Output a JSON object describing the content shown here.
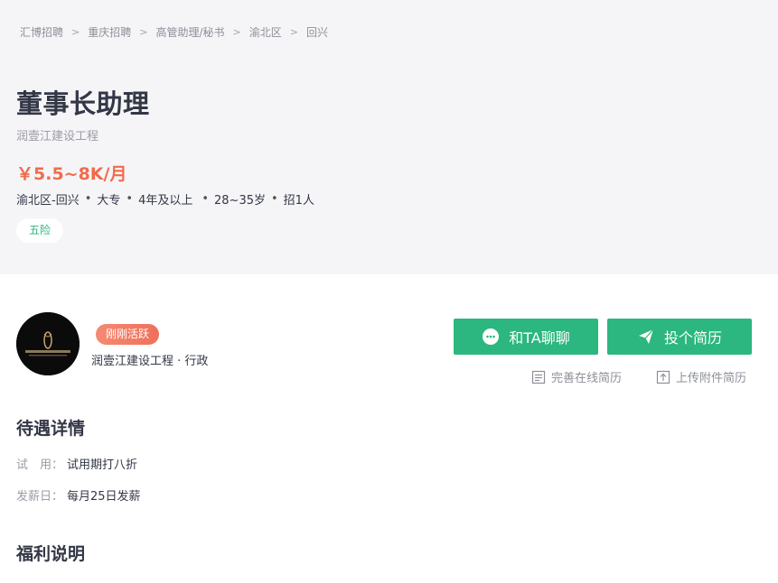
{
  "breadcrumb": [
    "汇博招聘",
    "重庆招聘",
    "高管助理/秘书",
    "渝北区",
    "回兴"
  ],
  "breadcrumb_sep": ">",
  "job": {
    "title": "董事长助理",
    "company": "润壹江建设工程",
    "salary": "￥5.5~8K/月",
    "meta": [
      "渝北区-回兴",
      "大专",
      "4年及以上",
      "28~35岁",
      "招1人"
    ],
    "tag": "五险"
  },
  "recruiter": {
    "active_badge": "刚刚活跃",
    "company_line": "润壹江建设工程 · 行政"
  },
  "actions": {
    "chat_label": "和TA聊聊",
    "apply_label": "投个简历",
    "online_resume": "完善在线简历",
    "upload_resume": "上传附件简历"
  },
  "treatment": {
    "title": "待遇详情",
    "rows": [
      {
        "key": "试　用：",
        "value": "试用期打八折"
      },
      {
        "key": "发薪日：",
        "value": "每月25日发薪"
      }
    ]
  },
  "welfare": {
    "title": "福利说明"
  },
  "colors": {
    "accent_green": "#2bb77f",
    "salary_orange": "#f26b4c"
  }
}
